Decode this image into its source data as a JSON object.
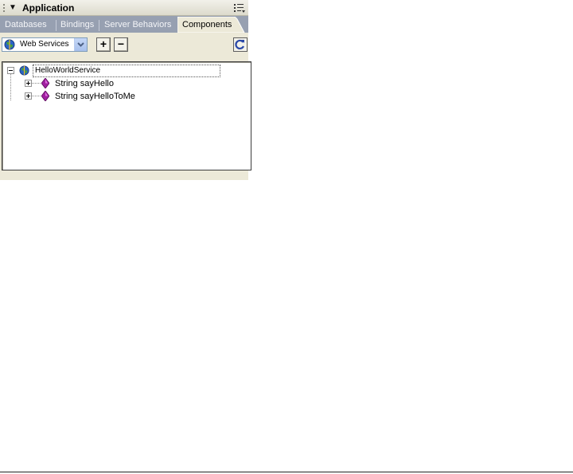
{
  "panel": {
    "title": "Application",
    "collapse_icon": "triangle-down-icon",
    "options_icon": "panel-options-icon"
  },
  "tabs": [
    {
      "label": "Databases",
      "active": false
    },
    {
      "label": "Bindings",
      "active": false
    },
    {
      "label": "Server Behaviors",
      "active": false
    },
    {
      "label": "Components",
      "active": true
    }
  ],
  "toolbar": {
    "component_type": "Web Services",
    "add_label": "+",
    "remove_label": "−",
    "refresh_icon": "refresh-icon"
  },
  "tree": {
    "root": {
      "label": "HelloWorldService",
      "icon": "globe-icon",
      "expanded": true,
      "children": [
        {
          "label": "String sayHello",
          "icon": "method-diamond-icon",
          "expanded": false
        },
        {
          "label": "String sayHelloToMe",
          "icon": "method-diamond-icon",
          "expanded": false
        }
      ]
    }
  },
  "colors": {
    "panel_bg": "#ece9d8",
    "tab_bar": "#97a0b1",
    "method_icon": "#a020a0",
    "globe_blue": "#2b63c6",
    "globe_green": "#4aa23a"
  }
}
